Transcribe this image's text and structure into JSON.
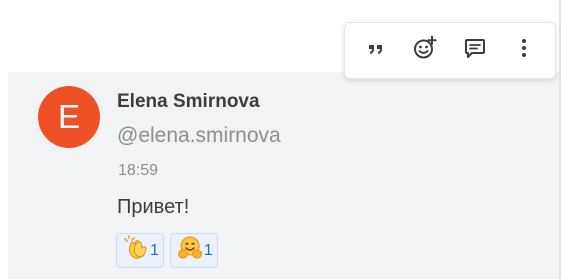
{
  "post": {
    "avatar_initial": "E",
    "display_name": "Elena Smirnova",
    "username": "@elena.smirnova",
    "timestamp": "18:59",
    "message": "Привет!"
  },
  "reactions": [
    {
      "emoji": "clapping-hands",
      "count": "1"
    },
    {
      "emoji": "hugging-face",
      "count": "1"
    }
  ],
  "toolbar": {
    "actions": [
      "quote",
      "add-reaction",
      "reply",
      "more-actions"
    ]
  },
  "colors": {
    "avatar": "#ef5126",
    "message_bg": "#f2f3f5",
    "reaction_bg": "#eaf1fb",
    "reaction_border": "#c9dbf3",
    "reaction_count": "#1f6bd1"
  }
}
